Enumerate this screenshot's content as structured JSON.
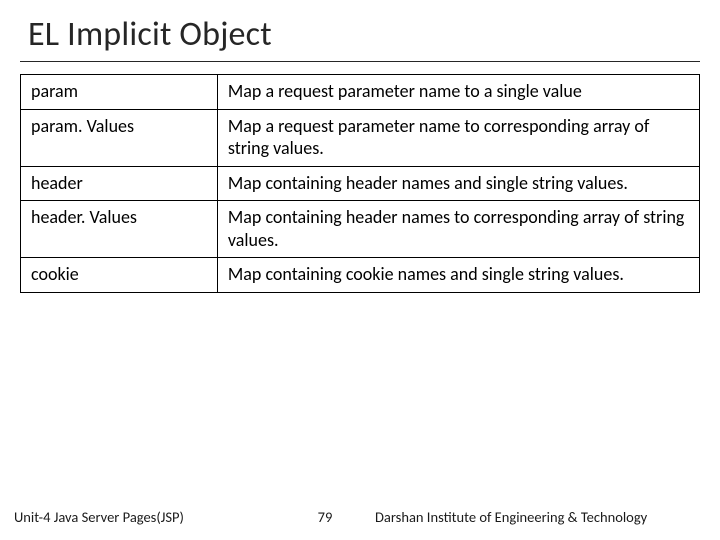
{
  "title": "EL Implicit Object",
  "table": {
    "rows": [
      {
        "name": "param",
        "desc": "Map a request parameter name to a single value"
      },
      {
        "name": "param. Values",
        "desc": "Map a request parameter name to corresponding array of string values."
      },
      {
        "name": "header",
        "desc": "Map containing header names and single string values."
      },
      {
        "name": "header. Values",
        "desc": "Map containing header names to corresponding array of string values."
      },
      {
        "name": "cookie",
        "desc": "Map containing cookie names and single string values."
      }
    ]
  },
  "footer": {
    "left": "Unit-4 Java Server Pages(JSP)",
    "page": "79",
    "right": "Darshan Institute of Engineering & Technology"
  }
}
